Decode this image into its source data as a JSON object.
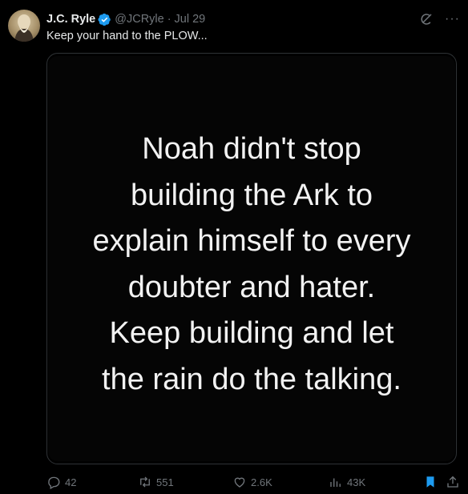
{
  "tweet": {
    "author_name": "J.C. Ryle",
    "handle": "@JCRyle",
    "separator": "·",
    "date": "Jul 29",
    "text": "Keep your hand to the PLOW...",
    "more_label": "···"
  },
  "media": {
    "lines": [
      "Noah didn't stop",
      "building the Ark to",
      "explain himself to every",
      "doubter and hater.",
      "Keep building and let",
      "the rain do the talking."
    ]
  },
  "actions": {
    "replies": "42",
    "reposts": "551",
    "likes": "2.6K",
    "views": "43K"
  },
  "colors": {
    "background": "#000000",
    "text": "#e7e9ea",
    "muted": "#71767b",
    "verified": "#1d9bf0",
    "bookmark": "#1d9bf0"
  },
  "icons": [
    "verified-badge-icon",
    "grok-icon",
    "more-icon",
    "reply-icon",
    "repost-icon",
    "like-icon",
    "views-icon",
    "bookmark-icon",
    "share-icon"
  ]
}
